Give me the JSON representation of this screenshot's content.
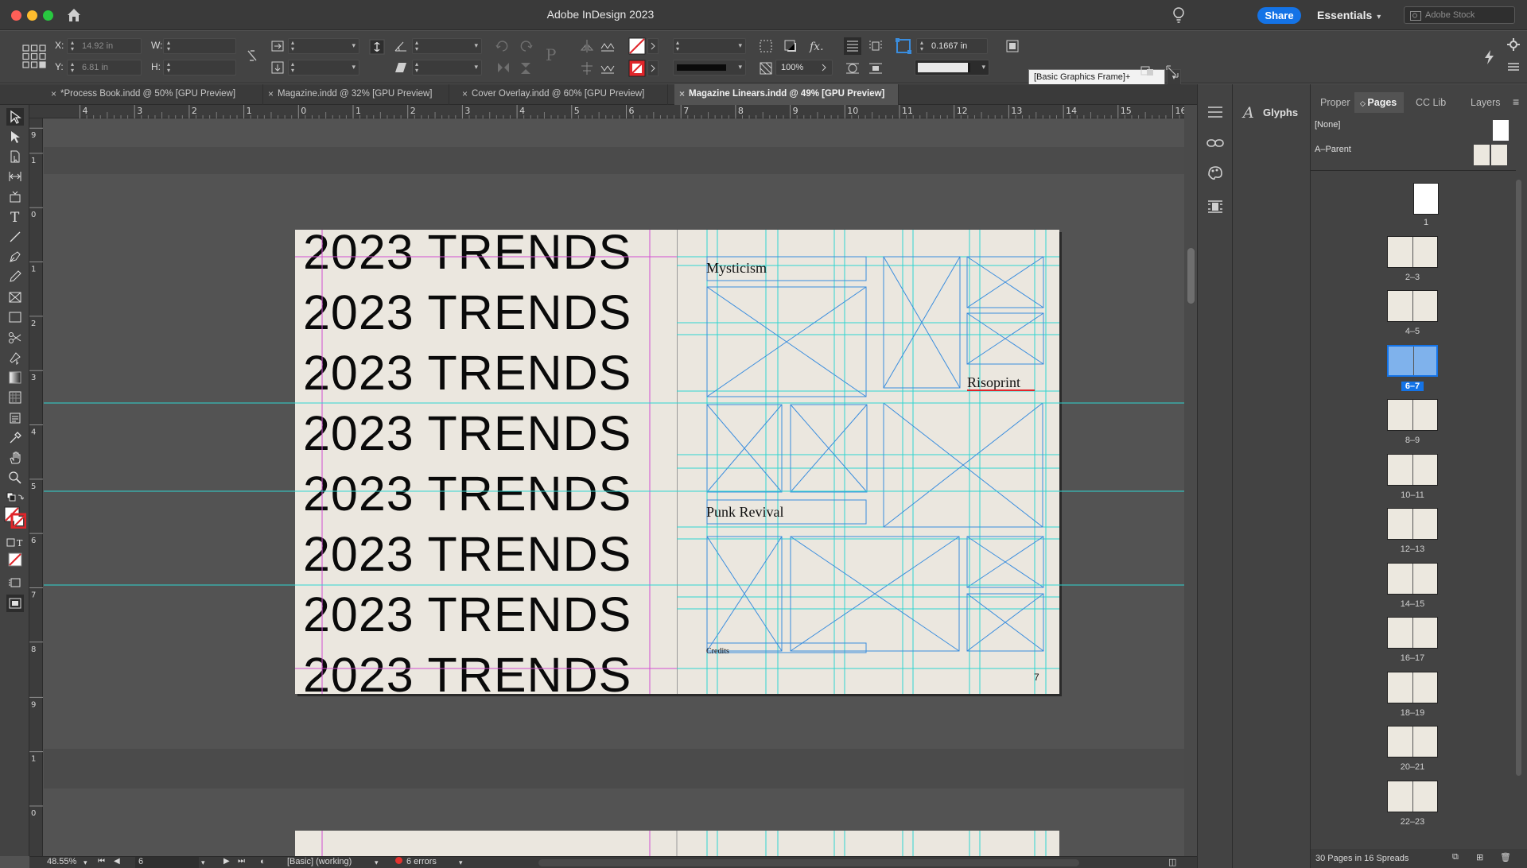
{
  "window": {
    "title": "Adobe InDesign 2023",
    "share_label": "Share",
    "workspace": "Essentials",
    "stock_placeholder": "Adobe Stock"
  },
  "control": {
    "x_label": "X:",
    "x_value": "14.92 in",
    "y_label": "Y:",
    "y_value": "6.81 in",
    "w_label": "W:",
    "h_label": "H:",
    "stroke_weight": "0.1667 in",
    "opacity": "100%",
    "object_style": "[Basic Graphics Frame]+"
  },
  "tabs": [
    {
      "label": "*Process Book.indd @ 50% [GPU Preview]",
      "active": false
    },
    {
      "label": "Magazine.indd @ 32% [GPU Preview]",
      "active": false
    },
    {
      "label": "Cover Overlay.indd @ 60% [GPU Preview]",
      "active": false
    },
    {
      "label": "Magazine Linears.indd @ 49% [GPU Preview]",
      "active": true
    }
  ],
  "rulers": {
    "horizontal": [
      "4",
      "3",
      "2",
      "1",
      "0",
      "1",
      "2",
      "3",
      "4",
      "5",
      "6",
      "7",
      "8",
      "9",
      "10",
      "11",
      "12",
      "13",
      "14",
      "15",
      "16"
    ],
    "vertical": [
      "9",
      "1",
      "0",
      "1",
      "2",
      "3",
      "4",
      "5",
      "6",
      "7",
      "8",
      "9",
      "1",
      "0"
    ]
  },
  "document": {
    "headline_lines": [
      "2023 TRENDS",
      "2023 TRENDS",
      "2023 TRENDS",
      "2023 TRENDS",
      "2023 TRENDS",
      "2023 TRENDS",
      "2023 TRENDS",
      "2023 TRENDS"
    ],
    "labels": {
      "mysticism": "Mysticism",
      "risoprint": "Risoprint",
      "punk": "Punk Revival",
      "credits": "Credits",
      "page_number": "7"
    }
  },
  "status": {
    "zoom": "48.55%",
    "page": "6",
    "preflight_profile": "[Basic] (working)",
    "errors": "6 errors"
  },
  "panels": {
    "glyphs": "Glyphs",
    "tabs": [
      "Proper",
      "Pages",
      "CC Lib",
      "Layers"
    ],
    "parents": [
      "[None]",
      "A–Parent"
    ],
    "thumb_labels": [
      "1",
      "2–3",
      "4–5",
      "6–7",
      "8–9",
      "10–11",
      "12–13",
      "14–15",
      "16–17",
      "18–19",
      "20–21",
      "22–23"
    ],
    "selected_label": "6–7",
    "footer": "30 Pages in 16 Spreads"
  },
  "colors": {
    "accent": "#1473e6",
    "guide_cyan": "#2fd6d0",
    "frame_blue": "#3a8dde",
    "margin_magenta": "#d14fd1",
    "page_bg": "#ebe7df"
  }
}
